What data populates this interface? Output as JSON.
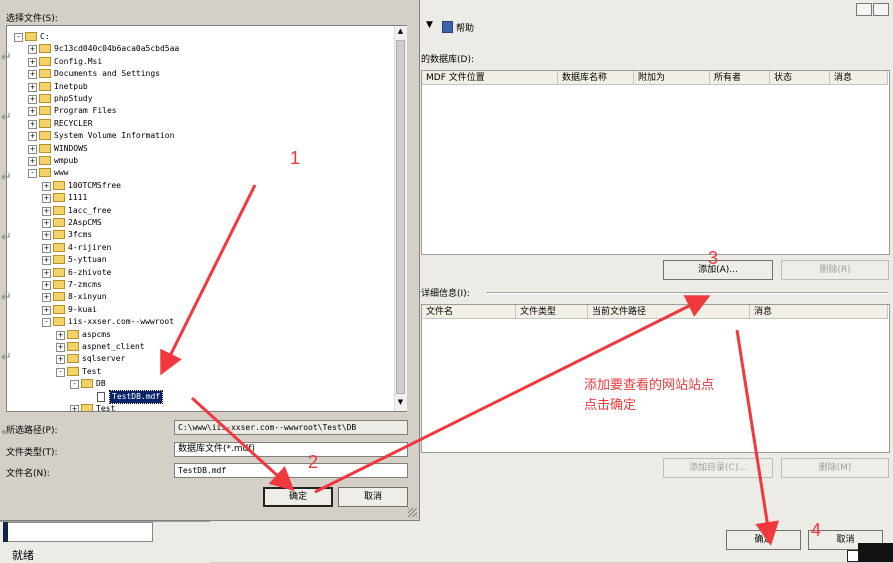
{
  "dialog": {
    "select_file_label": "选择文件(S):",
    "tree": [
      {
        "label": "C:",
        "depth": 0,
        "expander": "-"
      },
      {
        "label": "9c13cd040c04b6aca0a5cbd5aa",
        "depth": 1,
        "expander": "+"
      },
      {
        "label": "Config.Msi",
        "depth": 1,
        "expander": "+"
      },
      {
        "label": "Documents and Settings",
        "depth": 1,
        "expander": "+"
      },
      {
        "label": "Inetpub",
        "depth": 1,
        "expander": "+"
      },
      {
        "label": "phpStudy",
        "depth": 1,
        "expander": "+"
      },
      {
        "label": "Program Files",
        "depth": 1,
        "expander": "+"
      },
      {
        "label": "RECYCLER",
        "depth": 1,
        "expander": "+"
      },
      {
        "label": "System Volume Information",
        "depth": 1,
        "expander": "+"
      },
      {
        "label": "WINDOWS",
        "depth": 1,
        "expander": "+"
      },
      {
        "label": "wmpub",
        "depth": 1,
        "expander": "+"
      },
      {
        "label": "www",
        "depth": 1,
        "expander": "-"
      },
      {
        "label": "100TCMSfree",
        "depth": 2,
        "expander": "+"
      },
      {
        "label": "1111",
        "depth": 2,
        "expander": "+"
      },
      {
        "label": "1acc_free",
        "depth": 2,
        "expander": "+"
      },
      {
        "label": "2AspCMS",
        "depth": 2,
        "expander": "+"
      },
      {
        "label": "3fcms",
        "depth": 2,
        "expander": "+"
      },
      {
        "label": "4-rijiren",
        "depth": 2,
        "expander": "+"
      },
      {
        "label": "5-yttuan",
        "depth": 2,
        "expander": "+"
      },
      {
        "label": "6-zhivote",
        "depth": 2,
        "expander": "+"
      },
      {
        "label": "7-zmcms",
        "depth": 2,
        "expander": "+"
      },
      {
        "label": "8-xinyun",
        "depth": 2,
        "expander": "+"
      },
      {
        "label": "9-kuai",
        "depth": 2,
        "expander": "+"
      },
      {
        "label": "iis-xxser.com--wwwroot",
        "depth": 2,
        "expander": "-"
      },
      {
        "label": "aspcms",
        "depth": 3,
        "expander": "+"
      },
      {
        "label": "aspnet_client",
        "depth": 3,
        "expander": "+"
      },
      {
        "label": "sqlserver",
        "depth": 3,
        "expander": "+"
      },
      {
        "label": "Test",
        "depth": 3,
        "expander": "-"
      },
      {
        "label": "DB",
        "depth": 4,
        "expander": "-"
      },
      {
        "label": "TestDB.mdf",
        "depth": 5,
        "expander": "",
        "file": true,
        "selected": true
      },
      {
        "label": "Test",
        "depth": 4,
        "expander": "+"
      }
    ],
    "selected_path_label": "所选路径(P):",
    "selected_path_value": "C:\\www\\iis-xxser.com--wwwroot\\Test\\DB",
    "file_type_label": "文件类型(T):",
    "file_type_value": "数据库文件(*.mdf)",
    "file_name_label": "文件名(N):",
    "file_name_value": "TestDB.mdf",
    "ok_label": "确定",
    "cancel_label": "取消"
  },
  "background": {
    "menu_help": "帮助",
    "databases_label": "的数据库(D):",
    "db_columns": [
      "MDF 文件位置",
      "数据库名称",
      "附加为",
      "所有者",
      "状态",
      "消息"
    ],
    "add_button": "添加(A)...",
    "remove_button": "删除(R)",
    "details_label": "详细信息(I):",
    "detail_columns": [
      "文件名",
      "文件类型",
      "当前文件路径",
      "消息"
    ],
    "add_dir_button": "添加目录(C)...",
    "remove_button2": "删除(M)",
    "ok_label": "确定",
    "cancel_label": "取消",
    "status_text": "就绪"
  },
  "annotations": {
    "step1": "1",
    "step2": "2",
    "step3": "3",
    "step4": "4",
    "note_line1": "添加要查看的网站站点",
    "note_line2": "点击确定",
    "color": "#f0383d"
  }
}
